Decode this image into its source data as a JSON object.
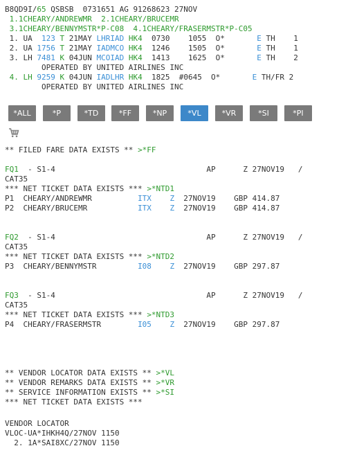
{
  "header": {
    "pnr_locator": "B8QD9I/",
    "pnr_seq": "65",
    "pnr_rest": " QSBSB  0731651 AG 91268623 27NOV"
  },
  "names": {
    "line1": " 1.1CHEARY/ANDREWMR  2.1CHEARY/BRUCEMR",
    "line2": " 3.1CHEARY/BENNYMSTR*P-C08  4.1CHEARY/FRASERMSTR*P-C05"
  },
  "segments": [
    {
      "pre": " 1. UA  ",
      "flight": "123",
      "cls": " T",
      "date": " 21MAY ",
      "city": "LHRIAD",
      "status": " HK4",
      "times": "  0730    1055  O*       ",
      "e": "E",
      "days": " TH    1"
    },
    {
      "pre": " 2. UA ",
      "flight": "1756",
      "cls": " T",
      "date": " 21MAY ",
      "city": "IADMCO",
      "status": " HK4",
      "times": "  1246    1505  O*       ",
      "e": "E",
      "days": " TH    1"
    },
    {
      "pre": " 3. LH ",
      "flight": "7481",
      "cls": " K",
      "date": " 04JUN ",
      "city": "MCOIAD",
      "status": " HK4",
      "times": "  1413    1625  O*       ",
      "e": "E",
      "days": " TH    2"
    },
    {
      "pre": " 4. LH ",
      "flight": "9259",
      "cls": " K",
      "date": " 04JUN ",
      "city": "IADLHR",
      "status": " HK4",
      "times": "  1825  #0645  O*       ",
      "e": "E",
      "days": " TH/FR 2"
    }
  ],
  "operated_by": "        OPERATED BY UNITED AIRLINES INC",
  "toolbar": {
    "buttons": [
      "*ALL",
      "*P",
      "*TD",
      "*FF",
      "*NP",
      "*VL",
      "*VR",
      "*SI",
      "*PI"
    ],
    "active": "*VL"
  },
  "filed_fare": {
    "text": "** FILED FARE DATA EXISTS ** ",
    "link": ">*FF"
  },
  "fare_quotes": [
    {
      "fq": "FQ1",
      "head": "  - S1-4                                 AP      Z 27NOV19   /",
      "cat": "CAT35",
      "net": "*** NET TICKET DATA EXISTS *** ",
      "net_link": ">*NTD1",
      "pax": [
        {
          "p": "P1  CHEARY/ANDREWMR          ",
          "fare": "ITX",
          "z": "Z",
          "rest": "  27NOV19    GBP 414.87"
        },
        {
          "p": "P2  CHEARY/BRUCEMR           ",
          "fare": "ITX",
          "z": "Z",
          "rest": "  27NOV19    GBP 414.87"
        }
      ]
    },
    {
      "fq": "FQ2",
      "head": "  - S1-4                                 AP      Z 27NOV19   /",
      "cat": "CAT35",
      "net": "*** NET TICKET DATA EXISTS *** ",
      "net_link": ">*NTD2",
      "pax": [
        {
          "p": "P3  CHEARY/BENNYMSTR         ",
          "fare": "I08",
          "z": "Z",
          "rest": "  27NOV19    GBP 297.87"
        }
      ]
    },
    {
      "fq": "FQ3",
      "head": "  - S1-4                                 AP      Z 27NOV19   /",
      "cat": "CAT35",
      "net": "*** NET TICKET DATA EXISTS *** ",
      "net_link": ">*NTD3",
      "pax": [
        {
          "p": "P4  CHEARY/FRASERMSTR        ",
          "fare": "I05",
          "z": "Z",
          "rest": "  27NOV19    GBP 297.87"
        }
      ]
    }
  ],
  "exists": [
    {
      "text": "** VENDOR LOCATOR DATA EXISTS ** ",
      "link": ">*VL"
    },
    {
      "text": "** VENDOR REMARKS DATA EXISTS ** ",
      "link": ">*VR"
    },
    {
      "text": "** SERVICE INFORMATION EXISTS ** ",
      "link": ">*SI"
    },
    {
      "text": "*** NET TICKET DATA EXISTS ***",
      "link": ""
    }
  ],
  "vendor": {
    "title": "VENDOR LOCATOR",
    "line1": "VLOC-UA*IHKH4Q/27NOV 1150",
    "line2": "  2. 1A*SAI8XC/27NOV 1150"
  },
  "icons": {
    "cart": "shopping-cart-icon"
  },
  "colors": {
    "green": "#2e9a2e",
    "blue": "#3a8fd6",
    "button": "#7a7a7a",
    "active_button": "#3d88c9"
  }
}
